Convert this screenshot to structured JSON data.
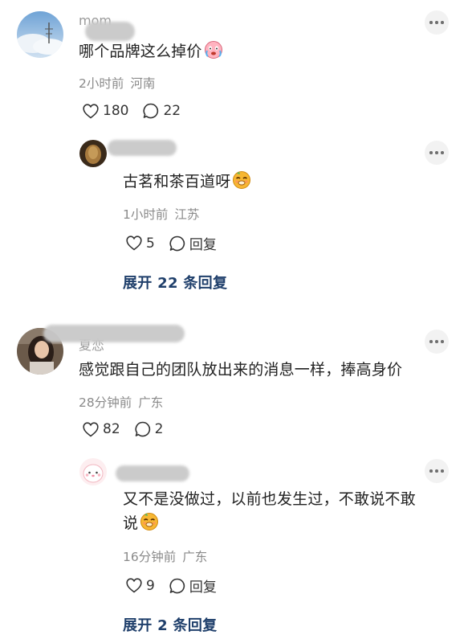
{
  "comments": [
    {
      "username": "mom",
      "text": "哪个品牌这么掉价",
      "emoji": "crying-face-emoji",
      "time": "2小时前",
      "location": "河南",
      "likes": "180",
      "replies": "22",
      "reply": {
        "text": "古茗和茶百道呀",
        "emoji": "smug-face-emoji",
        "time": "1小时前",
        "location": "江苏",
        "likes": "5",
        "reply_label": "回复"
      },
      "expand_label": "展开 22 条回复"
    },
    {
      "username": "夏恋",
      "text": "感觉跟自己的团队放出来的消息一样，捧高身价",
      "time": "28分钟前",
      "location": "广东",
      "likes": "82",
      "replies": "2",
      "reply": {
        "text_line1": "又不是没做过，以前也发生过，不敢说不敢",
        "text_line2": "说",
        "emoji": "smug-face-emoji",
        "time": "16分钟前",
        "location": "广东",
        "likes": "9",
        "reply_label": "回复"
      },
      "expand_label": "展开 2 条回复"
    }
  ],
  "colors": {
    "link": "#1f3f6b",
    "meta": "#8a8a8a",
    "more_bg": "#f2f2f2"
  }
}
